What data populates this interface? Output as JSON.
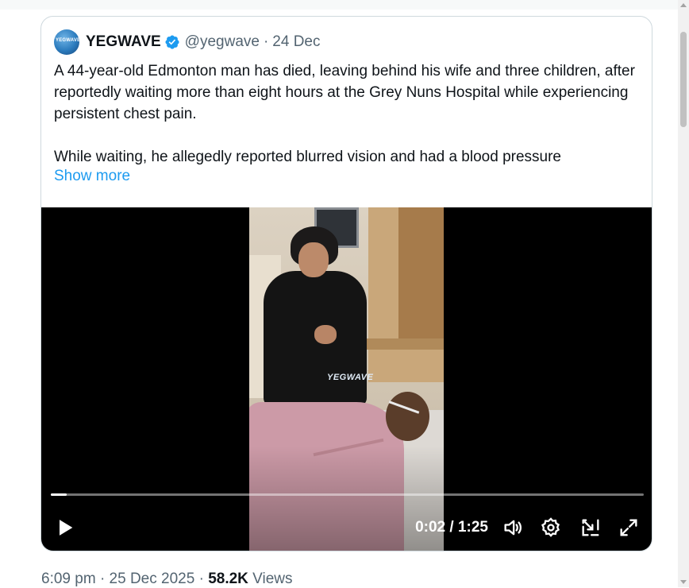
{
  "author": {
    "display_name": "YEGWAVE",
    "handle": "@yegwave",
    "separator": "·",
    "date": "24 Dec",
    "avatar_text": "YEGWAVE"
  },
  "tweet": {
    "paragraphs": [
      "A 44-year-old Edmonton man has died, leaving behind his wife and three children, after reportedly waiting more than eight hours at the Grey Nuns Hospital while experiencing persistent chest pain.",
      "While waiting, he allegedly reported blurred vision and had a blood pressure"
    ],
    "show_more": "Show more"
  },
  "video": {
    "watermark": "YEGWAVE",
    "current_time": "0:02",
    "time_separator": "/",
    "duration": "1:25",
    "progress_fraction": 0.027,
    "icons": [
      "play-icon",
      "volume-icon",
      "settings-icon",
      "picture-in-picture-icon",
      "fullscreen-icon"
    ]
  },
  "footer": {
    "time": "6:09 pm",
    "separator": "·",
    "date": "25 Dec 2025",
    "views_count": "58.2K",
    "views_label": "Views"
  },
  "colors": {
    "link": "#1d9bf0",
    "secondary_text": "#536471",
    "border": "#cfd9de",
    "verified": "#1d9bf0"
  }
}
